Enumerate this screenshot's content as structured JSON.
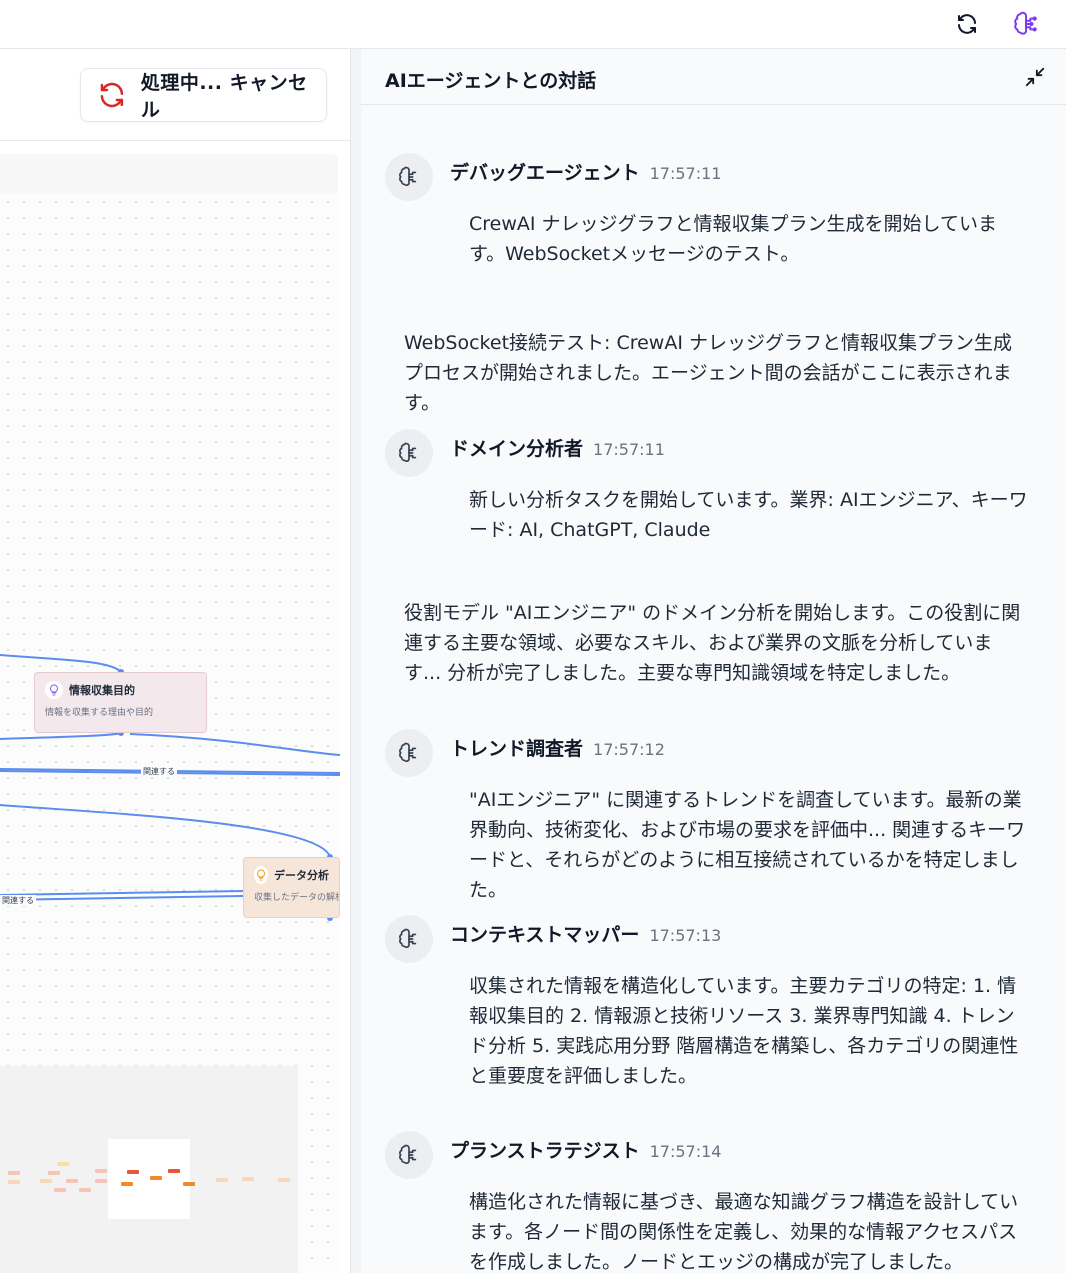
{
  "left_panel": {
    "cancel_button_label": "処理中... キャンセル",
    "nodes": {
      "info": {
        "title": "情報収集目的",
        "desc": "情報を収集する理由や目的"
      },
      "data": {
        "title": "データ分析",
        "desc": "収集したデータの解析と"
      }
    },
    "edge_labels": [
      "関連する",
      "関連する"
    ]
  },
  "chat": {
    "title": "AIエージェントとの対話",
    "messages": [
      {
        "sender": "デバッグエージェント",
        "time": "17:57:11",
        "text": "CrewAI ナレッジグラフと情報収集プラン生成を開始しています。WebSocketメッセージのテスト。"
      },
      {
        "plain": "WebSocket接続テスト: CrewAI ナレッジグラフと情報収集プラン生成プロセスが開始されました。エージェント間の会話がここに表示されます。"
      },
      {
        "sender": "ドメイン分析者",
        "time": "17:57:11",
        "text": "新しい分析タスクを開始しています。業界: AIエンジニア、キーワード: AI, ChatGPT, Claude"
      },
      {
        "plain": "役割モデル \"AIエンジニア\" のドメイン分析を開始します。この役割に関連する主要な領域、必要なスキル、および業界の文脈を分析しています... 分析が完了しました。主要な専門知識領域を特定しました。"
      },
      {
        "sender": "トレンド調査者",
        "time": "17:57:12",
        "text": "\"AIエンジニア\" に関連するトレンドを調査しています。最新の業界動向、技術変化、および市場の要求を評価中... 関連するキーワードと、それらがどのように相互接続されているかを特定しました。"
      },
      {
        "sender": "コンテキストマッパー",
        "time": "17:57:13",
        "text": "収集された情報を構造化しています。主要カテゴリの特定: 1. 情報収集目的 2. 情報源と技術リソース 3. 業界専門知識 4. トレンド分析 5. 実践応用分野 階層構造を構築し、各カテゴリの関連性と重要度を評価しました。"
      },
      {
        "sender": "プランストラテジスト",
        "time": "17:57:14",
        "text": "構造化された情報に基づき、最適な知識グラフ構造を設計しています。各ノード間の関係性を定義し、効果的な情報アクセスパスを作成しました。ノードとエッジの構成が完了しました。"
      }
    ]
  },
  "icons": {
    "refresh": "refresh-icon",
    "agent": "brain-circuit-icon",
    "collapse": "minimize-icon",
    "spinner": "loading-spinner-icon",
    "node": "lightbulb-icon"
  },
  "colors": {
    "accent_purple": "#7c3aed",
    "spinner_red": "#dc2626",
    "edge_blue": "#5b8def"
  }
}
